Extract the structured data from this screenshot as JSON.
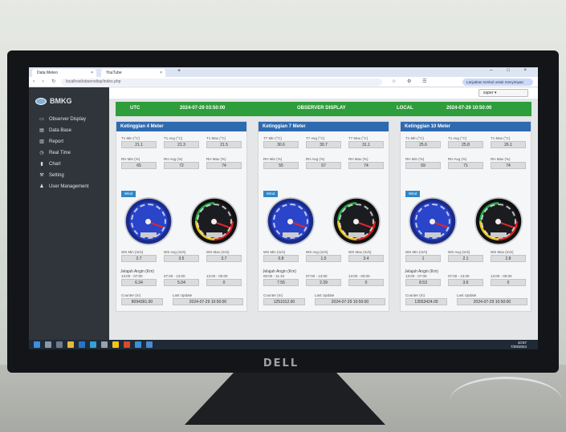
{
  "browser": {
    "tabs": [
      {
        "label": "Data Meteo"
      },
      {
        "label": "YouTube"
      }
    ],
    "new_tab": "+",
    "url": "localhost/observdisp/index.php",
    "resume_label": "Lanjutkan tombol untuk menyimpan"
  },
  "app": {
    "brand": "BMKG",
    "menu": [
      {
        "label": "Observer Display",
        "icon": "monitor-icon"
      },
      {
        "label": "Data Base",
        "icon": "database-icon"
      },
      {
        "label": "Report",
        "icon": "report-icon"
      },
      {
        "label": "Real Time",
        "icon": "clock-icon"
      },
      {
        "label": "Chart",
        "icon": "chart-icon"
      },
      {
        "label": "Setting",
        "icon": "wrench-icon"
      },
      {
        "label": "User Management",
        "icon": "user-icon"
      }
    ],
    "user_label": "super ▾"
  },
  "header": {
    "utc_label": "UTC",
    "utc_time": "2024-07-29 03:50:00",
    "title": "OBSERVER DISPLAY",
    "local_label": "LOCAL",
    "local_time": "2024-07-29 10:50:00"
  },
  "panels": [
    {
      "title": "Ketinggian 4 Meter",
      "t": [
        {
          "label": "T1 Min (°C)",
          "value": "21.1"
        },
        {
          "label": "T1 Avg (°C)",
          "value": "21.3"
        },
        {
          "label": "T1 Max (°C)",
          "value": "21.5"
        }
      ],
      "rh": [
        {
          "label": "RH Min (%)",
          "value": "65"
        },
        {
          "label": "RH Avg (%)",
          "value": "72"
        },
        {
          "label": "RH Max (%)",
          "value": "74"
        }
      ],
      "wind_badge": "Wind",
      "ws": [
        {
          "label": "WS Min (m/s)",
          "value": "2.7"
        },
        {
          "label": "WS Avg (m/s)",
          "value": "3.5"
        },
        {
          "label": "WS Max (m/s)",
          "value": "3.7"
        }
      ],
      "jelajah_label": "Jelajah Angin (Km)",
      "jelajah": [
        {
          "label": "13:00 - 07:00",
          "value": "6.34"
        },
        {
          "label": "07:00 - 13:00",
          "value": "5.04"
        },
        {
          "label": "13:00 - 00:00",
          "value": "0"
        }
      ],
      "counter_label": "Counter (m)",
      "counter_value": "8094391.00",
      "update_label": "Last Update",
      "update_value": "2024-07-29 10:50:00"
    },
    {
      "title": "Ketinggian 7 Meter",
      "t": [
        {
          "label": "T7 Min (°C)",
          "value": "30.6"
        },
        {
          "label": "T7 Avg (°C)",
          "value": "30.7"
        },
        {
          "label": "T7 Max (°C)",
          "value": "31.1"
        }
      ],
      "rh": [
        {
          "label": "RH Min (%)",
          "value": "55"
        },
        {
          "label": "RH Avg (%)",
          "value": "57"
        },
        {
          "label": "RH Max (%)",
          "value": "74"
        }
      ],
      "wind_badge": "Wind",
      "ws": [
        {
          "label": "WS Min (m/s)",
          "value": "0.8"
        },
        {
          "label": "WS Avg (m/s)",
          "value": "1.5"
        },
        {
          "label": "WS Max (m/s)",
          "value": "3.4"
        }
      ],
      "jelajah_label": "Jelajah Angin (Km)",
      "jelajah": [
        {
          "label": "00:00 - 11:10",
          "value": "7.55"
        },
        {
          "label": "07:00 - 13:00",
          "value": "2.39"
        },
        {
          "label": "13:00 - 00:00",
          "value": "0"
        }
      ],
      "counter_label": "Counter (m)",
      "counter_value": "1251012.00",
      "update_label": "Last Update",
      "update_value": "2024-07-29 10:50:00"
    },
    {
      "title": "Ketinggian 10 Meter",
      "t": [
        {
          "label": "T1 Min (°C)",
          "value": "25.6"
        },
        {
          "label": "T1 Avg (°C)",
          "value": "25.8"
        },
        {
          "label": "T1 Max (°C)",
          "value": "26.1"
        }
      ],
      "rh": [
        {
          "label": "RH Min (%)",
          "value": "69"
        },
        {
          "label": "RH Avg (%)",
          "value": "71"
        },
        {
          "label": "RH Max (%)",
          "value": "74"
        }
      ],
      "wind_badge": "Wind",
      "ws": [
        {
          "label": "WS Min (m/s)",
          "value": "1"
        },
        {
          "label": "WS Avg (m/s)",
          "value": "2.1"
        },
        {
          "label": "WS Max (m/s)",
          "value": "2.8"
        }
      ],
      "jelajah_label": "Jelajah Angin (Km)",
      "jelajah": [
        {
          "label": "13:00 - 07:00",
          "value": "8.53"
        },
        {
          "label": "07:00 - 13:00",
          "value": "3.6"
        },
        {
          "label": "13:00 - 00:00",
          "value": "0"
        }
      ],
      "counter_label": "Counter (m)",
      "counter_value": "13553424.00",
      "update_label": "Last Update",
      "update_value": "2024-07-29 10:50:00"
    }
  ],
  "taskbar": {
    "time": "10:57",
    "date": "7/29/2024"
  },
  "monitor": {
    "brand": "DELL"
  }
}
